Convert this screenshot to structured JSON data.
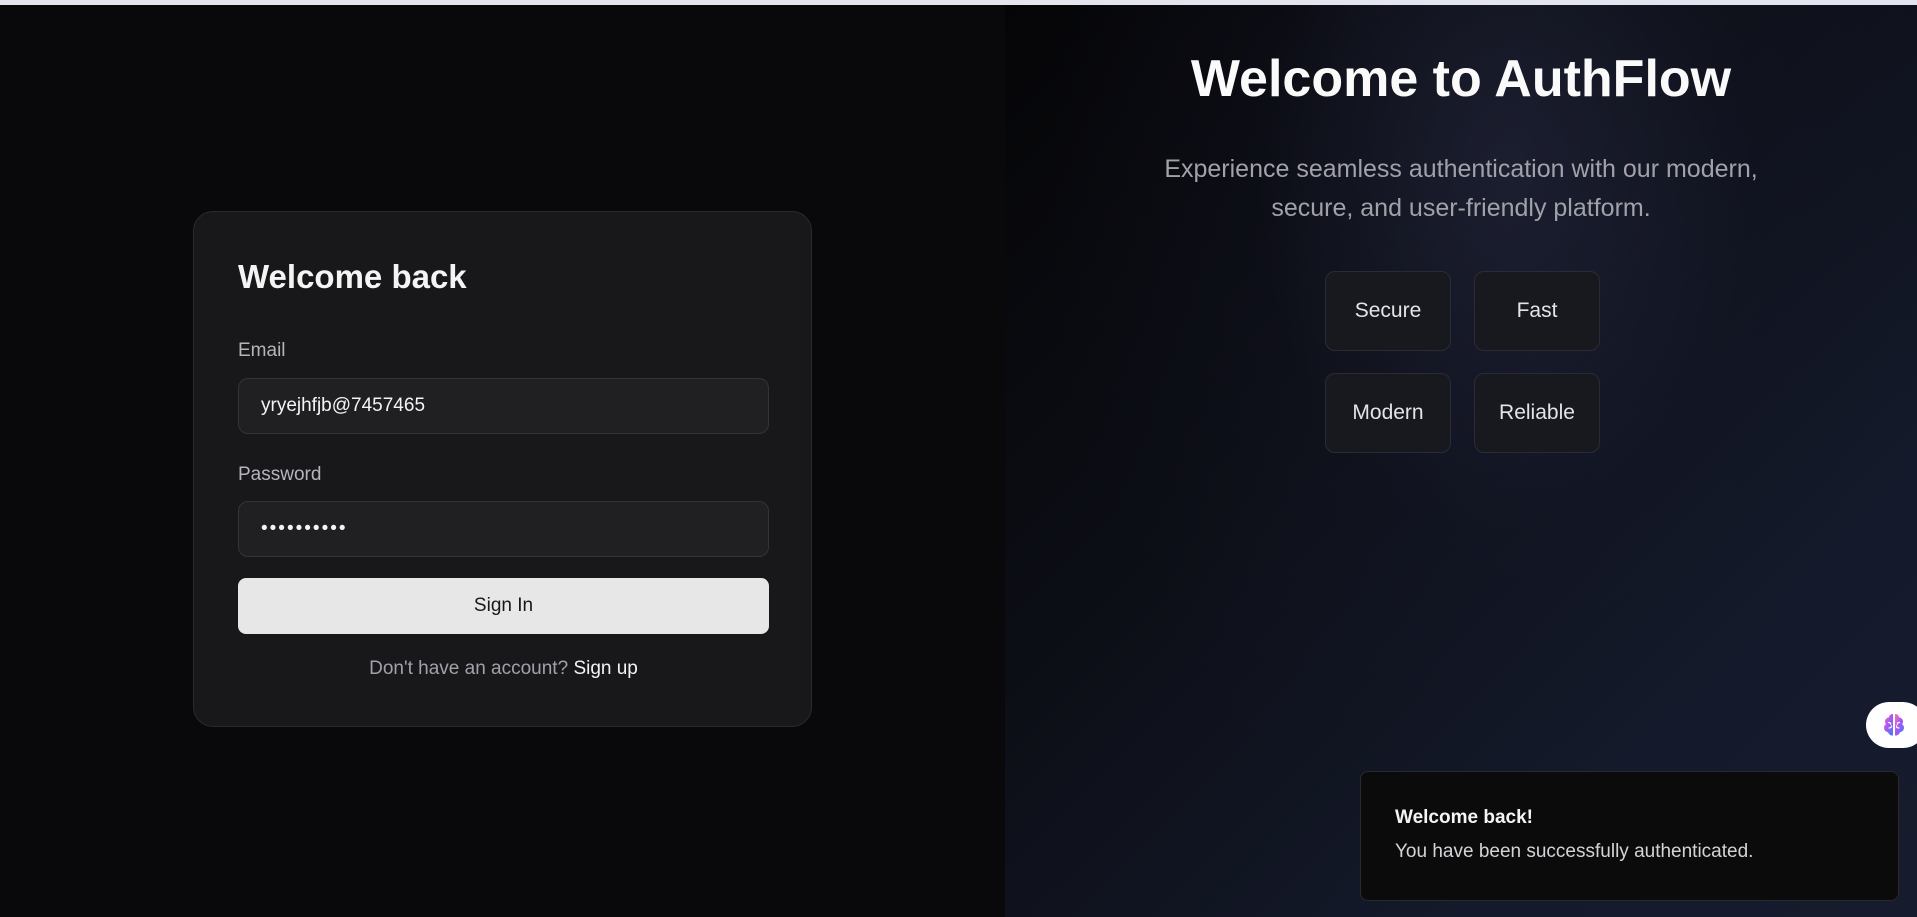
{
  "login": {
    "title": "Welcome back",
    "email_label": "Email",
    "email_value": "yryejhfjb@7457465",
    "password_label": "Password",
    "password_value": "••••••••••",
    "signin_label": "Sign In",
    "signup_prompt": "Don't have an account?",
    "signup_link": "Sign up"
  },
  "hero": {
    "title": "Welcome to AuthFlow",
    "subtitle": "Experience seamless authentication with our modern, secure, and user-friendly platform.",
    "features": [
      "Secure",
      "Fast",
      "Modern",
      "Reliable"
    ]
  },
  "toast": {
    "title": "Welcome back!",
    "message": "You have been successfully authenticated."
  },
  "icons": {
    "extension": "brain-icon"
  },
  "colors": {
    "background": "#09090b",
    "card": "#18181b",
    "button": "#e7e7e7"
  }
}
